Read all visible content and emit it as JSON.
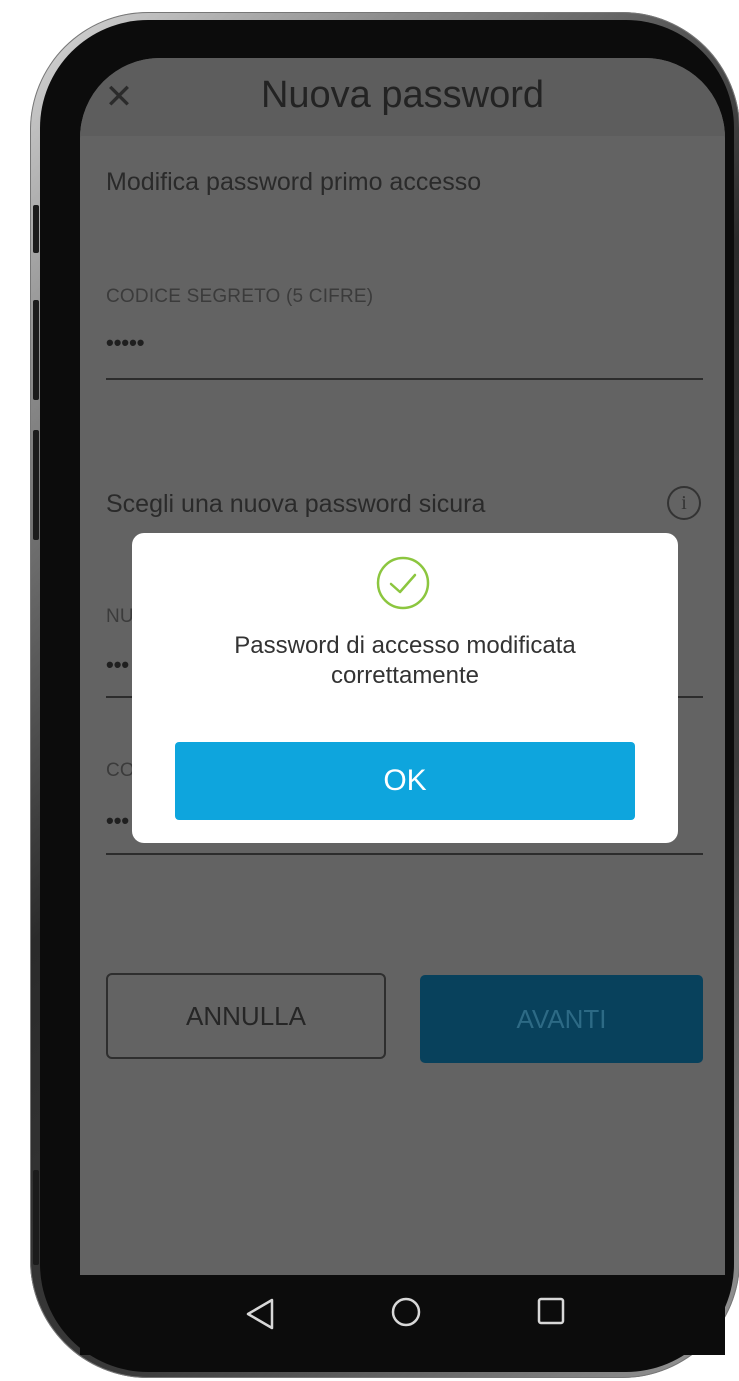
{
  "header": {
    "title": "Nuova password",
    "close_icon": "close-icon"
  },
  "form": {
    "subtitle": "Modifica password primo accesso",
    "secret_code": {
      "label": "CODICE SEGRETO (5 CIFRE)",
      "value": "•••••"
    },
    "section_title": "Scegli una nuova password sicura",
    "info_icon": "info-icon",
    "new_password": {
      "label_partial": "NU",
      "value_partial": "•••"
    },
    "confirm_password": {
      "label_partial": "CO",
      "value_partial": "•••"
    }
  },
  "buttons": {
    "cancel_label": "ANNULLA",
    "next_label": "AVANTI"
  },
  "dialog": {
    "icon": "check-circle-icon",
    "message_line1": "Password di accesso modificata",
    "message_line2": "correttamente",
    "ok_label": "OK"
  },
  "nav_bar": {
    "back_icon": "back-triangle-icon",
    "home_icon": "home-circle-icon",
    "recent_icon": "recent-square-icon"
  },
  "colors": {
    "accent": "#0ea5dd",
    "avanti_disabled": "#08415c",
    "overlay_gray": "#636363",
    "check_green": "#8cc63f"
  }
}
